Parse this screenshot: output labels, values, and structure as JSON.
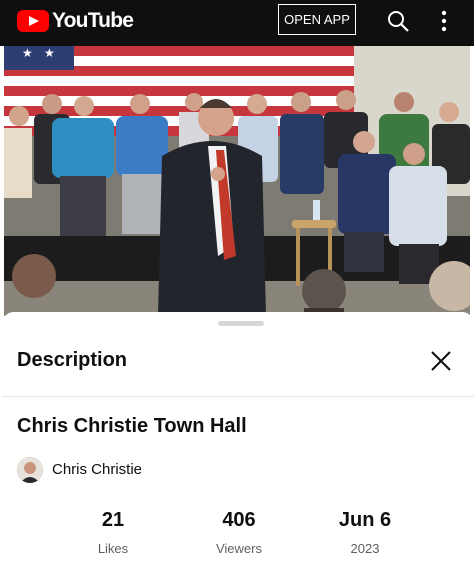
{
  "topbar": {
    "logo_text": "YouTube",
    "open_app_label": "OPEN APP",
    "icons": [
      "youtube-logo-icon",
      "search-icon",
      "more-vert-icon"
    ]
  },
  "description_panel": {
    "title": "Description",
    "video_title": "Chris Christie Town Hall",
    "channel_name": "Chris Christie",
    "stats": [
      {
        "value": "21",
        "label": "Likes"
      },
      {
        "value": "406",
        "label": "Viewers"
      },
      {
        "value": "Jun 6",
        "label": "2023"
      }
    ]
  },
  "colors": {
    "topbar_bg": "#0f0f0f",
    "brand_red": "#ff0000",
    "text_primary": "#0f0f0f",
    "text_secondary": "#606060"
  }
}
